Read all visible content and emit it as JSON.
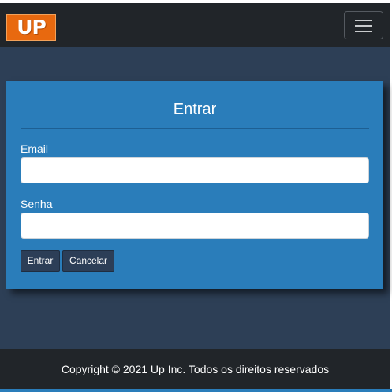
{
  "navbar": {
    "logo_text": "UP",
    "menu_toggle_icon": "hamburger-icon"
  },
  "login_card": {
    "title": "Entrar",
    "email_label": "Email",
    "email_value": "",
    "email_placeholder": "",
    "password_label": "Senha",
    "password_value": "",
    "password_placeholder": "",
    "submit_label": "Entrar",
    "cancel_label": "Cancelar"
  },
  "footer": {
    "copyright": "Copyright © 2021 Up Inc. Todos os direitos reservados"
  },
  "colors": {
    "page_background": "#2d3f56",
    "navbar": "#212529",
    "card": "#2a7dba",
    "logo": "#e8690f",
    "button": "#2c3e57"
  }
}
